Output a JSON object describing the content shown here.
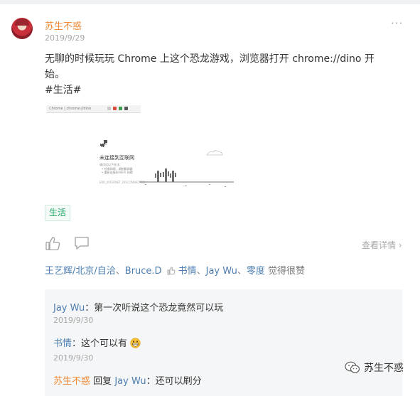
{
  "post": {
    "author": "苏生不惑",
    "date": "2019/9/29",
    "content_line1": "无聊的时候玩玩 Chrome 上这个恐龙游戏，浏览器打开 chrome://dino 开",
    "content_line2": "始。",
    "hashtag": "#生活#",
    "tag": "生活",
    "detail_link": "查看详情",
    "icons": {
      "like": "thumb-up-icon",
      "comment": "comment-icon",
      "more": "more-dots-icon"
    }
  },
  "screenshot": {
    "address": "Chrome  |  chrome://dino",
    "heading": "未连接到互联网",
    "line1": "请试试以下办法：",
    "line2": "• 检查网线、调制解调器",
    "line3": "• 重新连接到 Wi-Fi 网络",
    "error_code": "ERR_INTERNET_DISCONNECTED"
  },
  "likes": {
    "names": [
      "王艺辉/北京/自洽",
      "Bruce.D",
      "书情",
      "Jay Wu",
      "零度"
    ],
    "separator_comma": "、",
    "suffix": "觉得很赞"
  },
  "comments": [
    {
      "author": "Jay Wu",
      "text": "：第一次听说这个恐龙竟然可以玩",
      "date": "2019/9/30"
    },
    {
      "author": "书情",
      "text": "：这个可以有",
      "date": "2019/9/30",
      "emoji": "grinning-emoji"
    },
    {
      "author": "苏生不惑",
      "reply_word": "回复",
      "reply_to": "Jay Wu",
      "text": "：还可以刷分"
    }
  ],
  "watermark": {
    "text": "苏生不惑",
    "icon": "wechat-icon"
  },
  "colors": {
    "author": "#f08a37",
    "link": "#4d7eb0",
    "tag_green": "#19a463",
    "muted": "#a7a7a7"
  }
}
